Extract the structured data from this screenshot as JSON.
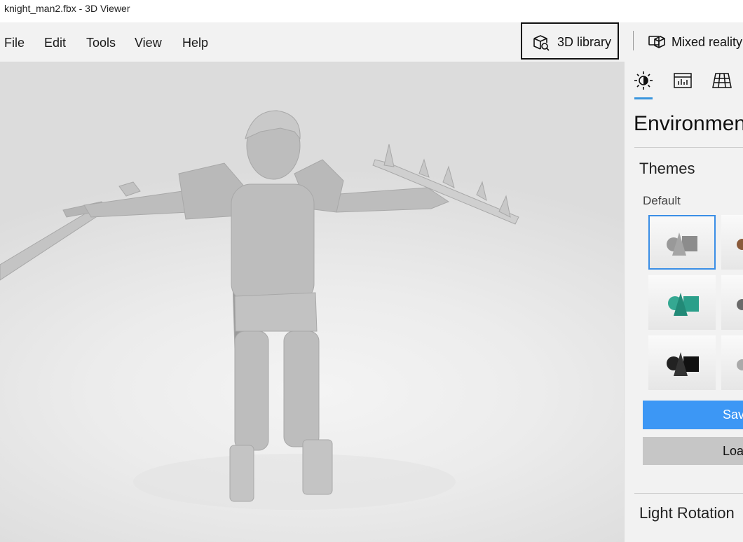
{
  "window": {
    "title": "knight_man2.fbx - 3D Viewer"
  },
  "menu": {
    "items": [
      "File",
      "Edit",
      "Tools",
      "View",
      "Help"
    ]
  },
  "toolbar": {
    "library_label": "3D library",
    "mixed_reality_label": "Mixed reality"
  },
  "panel": {
    "tabs": [
      {
        "name": "lighting-icon",
        "active": true
      },
      {
        "name": "stats-icon",
        "active": false
      },
      {
        "name": "grid-icon",
        "active": false
      }
    ],
    "title": "Environment",
    "themes_label": "Themes",
    "default_label": "Default",
    "save_label": "Save",
    "load_label": "Load",
    "light_rotation_label": "Light Rotation"
  },
  "colors": {
    "accent": "#3a96dd",
    "save_button": "#3c97f5",
    "load_button": "#c6c6c6",
    "model": "#bdbdbd"
  }
}
